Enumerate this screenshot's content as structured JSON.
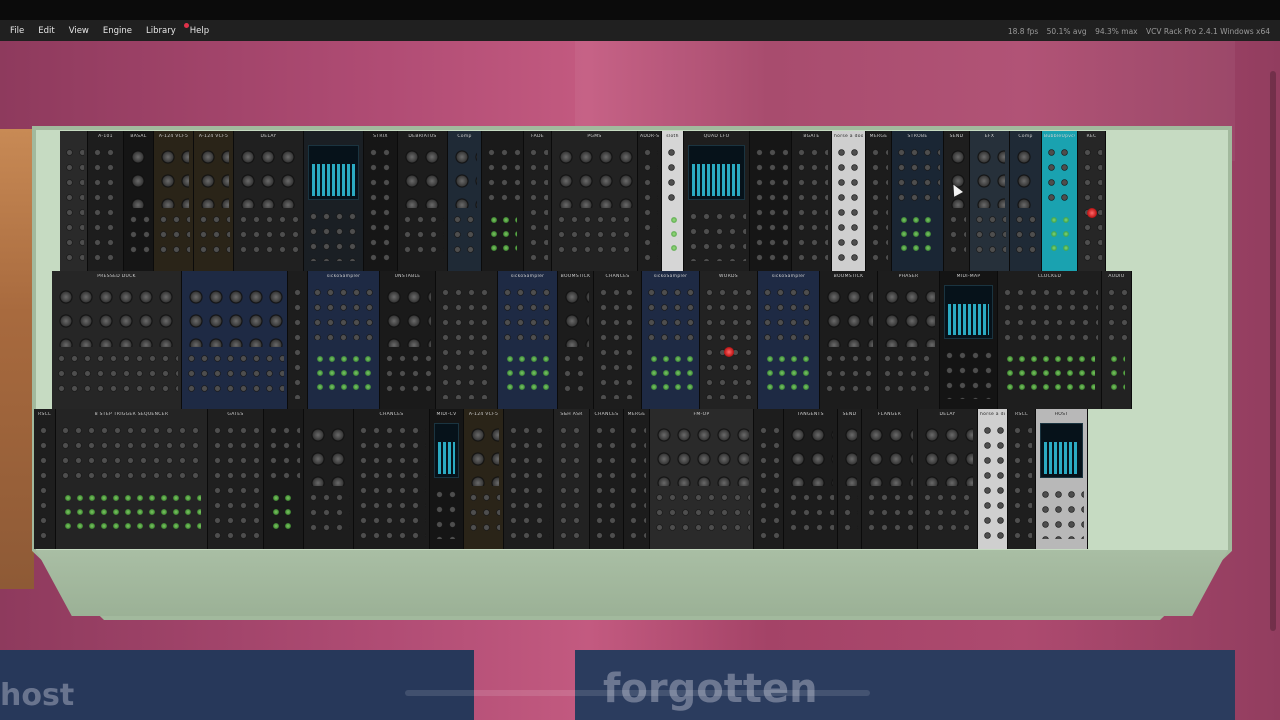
{
  "app": {
    "name": "VCV Rack Pro",
    "version": "2.4.1",
    "platform": "Windows x64"
  },
  "menu": [
    "File",
    "Edit",
    "View",
    "Engine",
    "Library",
    "Help"
  ],
  "status": {
    "fps": "18.8 fps",
    "avg": "50.1% avg",
    "max": "94.3% max",
    "app_label": "VCV Rack Pro 2.4.1 Windows x64"
  },
  "colors": {
    "wallpaper": "#b04c74",
    "rack_frame": "#a2b99d",
    "menubar": "#202020",
    "module_dark": "#1c1c1c",
    "lamp_green": "#8fe070",
    "lamp_red": "#e03a3a",
    "screen_cyan": "#2fbcd6"
  },
  "rack": {
    "rows": [
      {
        "name": "row-1",
        "modules": [
          {
            "label": "",
            "w": 28,
            "bg": "#2a2a2a",
            "kind": "jacks"
          },
          {
            "label": "A-101",
            "w": 36,
            "bg": "#1d1d1d",
            "kind": "jacks"
          },
          {
            "label": "BASAL",
            "w": 30,
            "bg": "#151515",
            "kind": "knobs"
          },
          {
            "label": "A-124 VCF5",
            "w": 40,
            "bg": "#2a2418",
            "kind": "knobs"
          },
          {
            "label": "A-124 VCF5",
            "w": 40,
            "bg": "#2a2418",
            "kind": "knobs"
          },
          {
            "label": "DELAY",
            "w": 70,
            "bg": "#202020",
            "kind": "knobs"
          },
          {
            "label": "",
            "w": 60,
            "bg": "#1a1f24",
            "kind": "screen"
          },
          {
            "label": "STRIX",
            "w": 34,
            "bg": "#161616",
            "kind": "jacks"
          },
          {
            "label": "DEBRIATUS",
            "w": 50,
            "bg": "#1c1c1c",
            "kind": "knobs"
          },
          {
            "label": "Comp",
            "w": 34,
            "bg": "#1f2a36",
            "kind": "knobs"
          },
          {
            "label": "",
            "w": 42,
            "bg": "#1a1a1a",
            "kind": "lamps"
          },
          {
            "label": "FADE",
            "w": 28,
            "bg": "#1e1e1e",
            "kind": "jacks"
          },
          {
            "label": "PGMS",
            "w": 86,
            "bg": "#222222",
            "kind": "knobs"
          },
          {
            "label": "ADDR-SEQ",
            "w": 24,
            "bg": "#1d1d1d",
            "kind": "jacks"
          },
          {
            "label": "sloth",
            "w": 22,
            "bg": "#d6d6d6",
            "kind": "lamps"
          },
          {
            "label": "QUAD LFO",
            "w": 66,
            "bg": "#1e1e1e",
            "kind": "screen"
          },
          {
            "label": "",
            "w": 42,
            "bg": "#161616",
            "kind": "jacks"
          },
          {
            "label": "8GATE",
            "w": 40,
            "bg": "#1d1d1d",
            "kind": "jacks"
          },
          {
            "label": "horse a doodle",
            "w": 34,
            "bg": "#cfcfcf",
            "kind": "jacks"
          },
          {
            "label": "MERGE",
            "w": 26,
            "bg": "#1c1c1c",
            "kind": "jacks"
          },
          {
            "label": "STROBE",
            "w": 52,
            "bg": "#1a2634",
            "kind": "lamps"
          },
          {
            "label": "SEND",
            "w": 26,
            "bg": "#1e1e1e",
            "kind": "knobs"
          },
          {
            "label": "EFX",
            "w": 40,
            "bg": "#26303a",
            "kind": "knobs"
          },
          {
            "label": "Comp",
            "w": 32,
            "bg": "#1f2a36",
            "kind": "knobs"
          },
          {
            "label": "BubbleUpvcv",
            "w": 36,
            "bg": "#1aa2b0",
            "kind": "lamps"
          },
          {
            "label": "REC",
            "w": 28,
            "bg": "#262626",
            "kind": "redlamp"
          }
        ]
      },
      {
        "name": "row-2",
        "modules": [
          {
            "label": "PRESSED DUCK",
            "w": 130,
            "bg": "#262626",
            "kind": "knobs"
          },
          {
            "label": "",
            "w": 106,
            "bg": "#1e2a44",
            "kind": "knobs"
          },
          {
            "label": "",
            "w": 20,
            "bg": "#1d1d1d",
            "kind": "jacks"
          },
          {
            "label": "sickoSampler",
            "w": 72,
            "bg": "#1e2a44",
            "kind": "lamps"
          },
          {
            "label": "UNSTABLE",
            "w": 56,
            "bg": "#1a1a1a",
            "kind": "knobs"
          },
          {
            "label": "",
            "w": 62,
            "bg": "#202020",
            "kind": "jacks"
          },
          {
            "label": "sickoSampler",
            "w": 60,
            "bg": "#1e2a44",
            "kind": "lamps"
          },
          {
            "label": "BOOMSTICK",
            "w": 36,
            "bg": "#1c1c1c",
            "kind": "knobs"
          },
          {
            "label": "CHANCES",
            "w": 48,
            "bg": "#1d1d1d",
            "kind": "jacks"
          },
          {
            "label": "sickoSampler",
            "w": 58,
            "bg": "#1e2a44",
            "kind": "lamps"
          },
          {
            "label": "WORDS",
            "w": 58,
            "bg": "#222222",
            "kind": "redlamp"
          },
          {
            "label": "sickoSampler",
            "w": 62,
            "bg": "#1e2a44",
            "kind": "lamps"
          },
          {
            "label": "BOOMSTICK",
            "w": 58,
            "bg": "#1c1c1c",
            "kind": "knobs"
          },
          {
            "label": "PHASER",
            "w": 62,
            "bg": "#1d1d1d",
            "kind": "knobs"
          },
          {
            "label": "MIDI-MAP",
            "w": 58,
            "bg": "#141414",
            "kind": "screen"
          },
          {
            "label": "CLOCKED",
            "w": 104,
            "bg": "#1e1e1e",
            "kind": "lamps"
          },
          {
            "label": "AUDIO",
            "w": 30,
            "bg": "#222222",
            "kind": "lamps"
          }
        ]
      },
      {
        "name": "row-3",
        "modules": [
          {
            "label": "RSCL",
            "w": 22,
            "bg": "#1e1e1e",
            "kind": "jacks"
          },
          {
            "label": "8 STEP TRIGGER SEQUENCER",
            "w": 152,
            "bg": "#242424",
            "kind": "lamps"
          },
          {
            "label": "GATES",
            "w": 56,
            "bg": "#1f1f1f",
            "kind": "jacks"
          },
          {
            "label": "",
            "w": 40,
            "bg": "#1a1a1a",
            "kind": "lamps"
          },
          {
            "label": "",
            "w": 50,
            "bg": "#1d1d1d",
            "kind": "knobs"
          },
          {
            "label": "CHANCES",
            "w": 76,
            "bg": "#1c1c1c",
            "kind": "jacks"
          },
          {
            "label": "MIDI-CV",
            "w": 34,
            "bg": "#151515",
            "kind": "screen"
          },
          {
            "label": "A-124 VCF5",
            "w": 40,
            "bg": "#2a2418",
            "kind": "knobs"
          },
          {
            "label": "",
            "w": 50,
            "bg": "#1d1d1d",
            "kind": "jacks"
          },
          {
            "label": "S&H ASR",
            "w": 36,
            "bg": "#222222",
            "kind": "jacks"
          },
          {
            "label": "CHANCES",
            "w": 34,
            "bg": "#1c1c1c",
            "kind": "jacks"
          },
          {
            "label": "MERGE",
            "w": 26,
            "bg": "#1c1c1c",
            "kind": "jacks"
          },
          {
            "label": "FM-OP",
            "w": 104,
            "bg": "#2a2a2a",
            "kind": "knobs"
          },
          {
            "label": "",
            "w": 30,
            "bg": "#1d1d1d",
            "kind": "jacks"
          },
          {
            "label": "TANGENTS",
            "w": 54,
            "bg": "#1c1c1c",
            "kind": "knobs"
          },
          {
            "label": "SEND",
            "w": 24,
            "bg": "#1e1e1e",
            "kind": "knobs"
          },
          {
            "label": "FLANGER",
            "w": 56,
            "bg": "#1d1d1d",
            "kind": "knobs"
          },
          {
            "label": "DELAY",
            "w": 60,
            "bg": "#202020",
            "kind": "knobs"
          },
          {
            "label": "horse a doodle",
            "w": 30,
            "bg": "#cfcfcf",
            "kind": "jacks"
          },
          {
            "label": "RSCL",
            "w": 28,
            "bg": "#1e1e1e",
            "kind": "jacks"
          },
          {
            "label": "HOST",
            "w": 52,
            "bg": "#b8b8b8",
            "kind": "screen"
          }
        ]
      }
    ]
  },
  "taskbar": {
    "left_text": "host",
    "right_text": "forgotten"
  }
}
